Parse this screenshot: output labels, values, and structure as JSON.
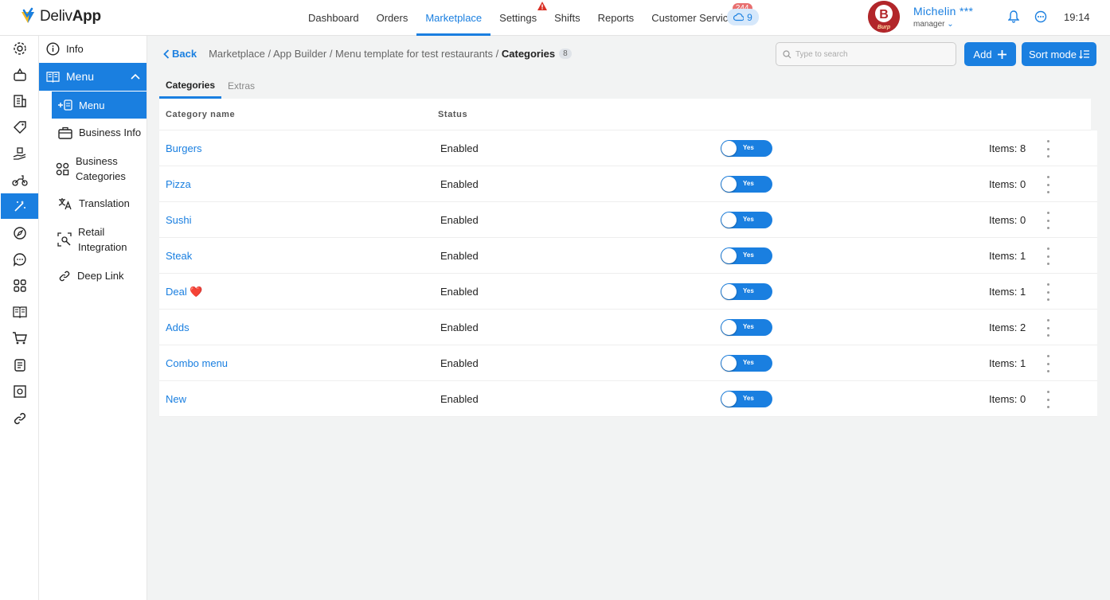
{
  "app": {
    "logo_text": "Deliv",
    "logo_text_bold": "App"
  },
  "nav": {
    "items": [
      {
        "label": "Dashboard"
      },
      {
        "label": "Orders"
      },
      {
        "label": "Marketplace",
        "active": true
      },
      {
        "label": "Settings"
      },
      {
        "label": "Shifts"
      },
      {
        "label": "Reports"
      },
      {
        "label": "Customer Service"
      }
    ],
    "customer_service_badge": "244",
    "sync_count": "9"
  },
  "user": {
    "name": "Michelin ***",
    "role": "manager",
    "avatar_letter": "B",
    "avatar_caption": "Burp"
  },
  "clock": "19:14",
  "subnav": {
    "info": "Info",
    "menu": "Menu",
    "menu_child": "Menu",
    "business_info": "Business Info",
    "business_categories_line1": "Business",
    "business_categories_line2": "Categories",
    "translation": "Translation",
    "retail_line1": "Retail",
    "retail_line2": "Integration",
    "deep_link": "Deep Link"
  },
  "breadcrumb": {
    "back": "Back",
    "path": "Marketplace / App Builder / Menu template for test restaurants / ",
    "current": "Categories",
    "count": "8"
  },
  "search": {
    "placeholder": "Type to search"
  },
  "actions": {
    "add_label": "Add",
    "sort_label": "Sort mode"
  },
  "tabs": [
    {
      "label": "Categories",
      "active": true
    },
    {
      "label": "Extras"
    }
  ],
  "table": {
    "columns": {
      "name": "Category name",
      "status": "Status"
    },
    "toggle_label": "Yes",
    "rows": [
      {
        "name": "Burgers",
        "status": "Enabled",
        "items": "Items: 8"
      },
      {
        "name": "Pizza",
        "status": "Enabled",
        "items": "Items: 0"
      },
      {
        "name": "Sushi",
        "status": "Enabled",
        "items": "Items: 0"
      },
      {
        "name": "Steak",
        "status": "Enabled",
        "items": "Items: 1"
      },
      {
        "name": "Deal ❤️",
        "status": "Enabled",
        "items": "Items: 1"
      },
      {
        "name": "Adds",
        "status": "Enabled",
        "items": "Items: 2"
      },
      {
        "name": "Combo menu",
        "status": "Enabled",
        "items": "Items: 1"
      },
      {
        "name": "New",
        "status": "Enabled",
        "items": "Items: 0"
      }
    ]
  },
  "colors": {
    "accent": "#1a7fe0",
    "badge": "#e86f6f",
    "alert": "#d93025"
  }
}
